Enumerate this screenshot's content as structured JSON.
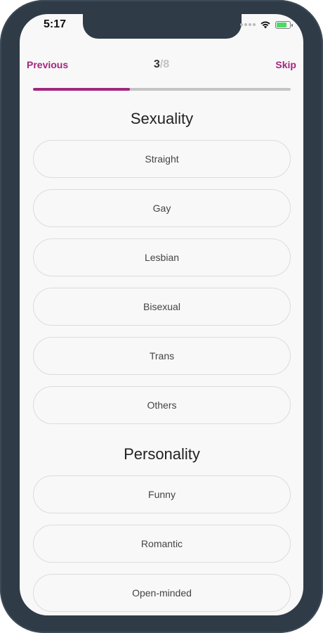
{
  "status_bar": {
    "time": "5:17"
  },
  "nav": {
    "previous_label": "Previous",
    "skip_label": "Skip",
    "step_current": "3",
    "step_separator": "/",
    "step_total": "8",
    "progress_fraction": 0.375
  },
  "colors": {
    "accent": "#a3267d",
    "device_frame": "#2f3b47"
  },
  "sections": [
    {
      "title": "Sexuality",
      "options": [
        "Straight",
        "Gay",
        "Lesbian",
        "Bisexual",
        "Trans",
        "Others"
      ]
    },
    {
      "title": "Personality",
      "options": [
        "Funny",
        "Romantic",
        "Open-minded"
      ]
    }
  ]
}
